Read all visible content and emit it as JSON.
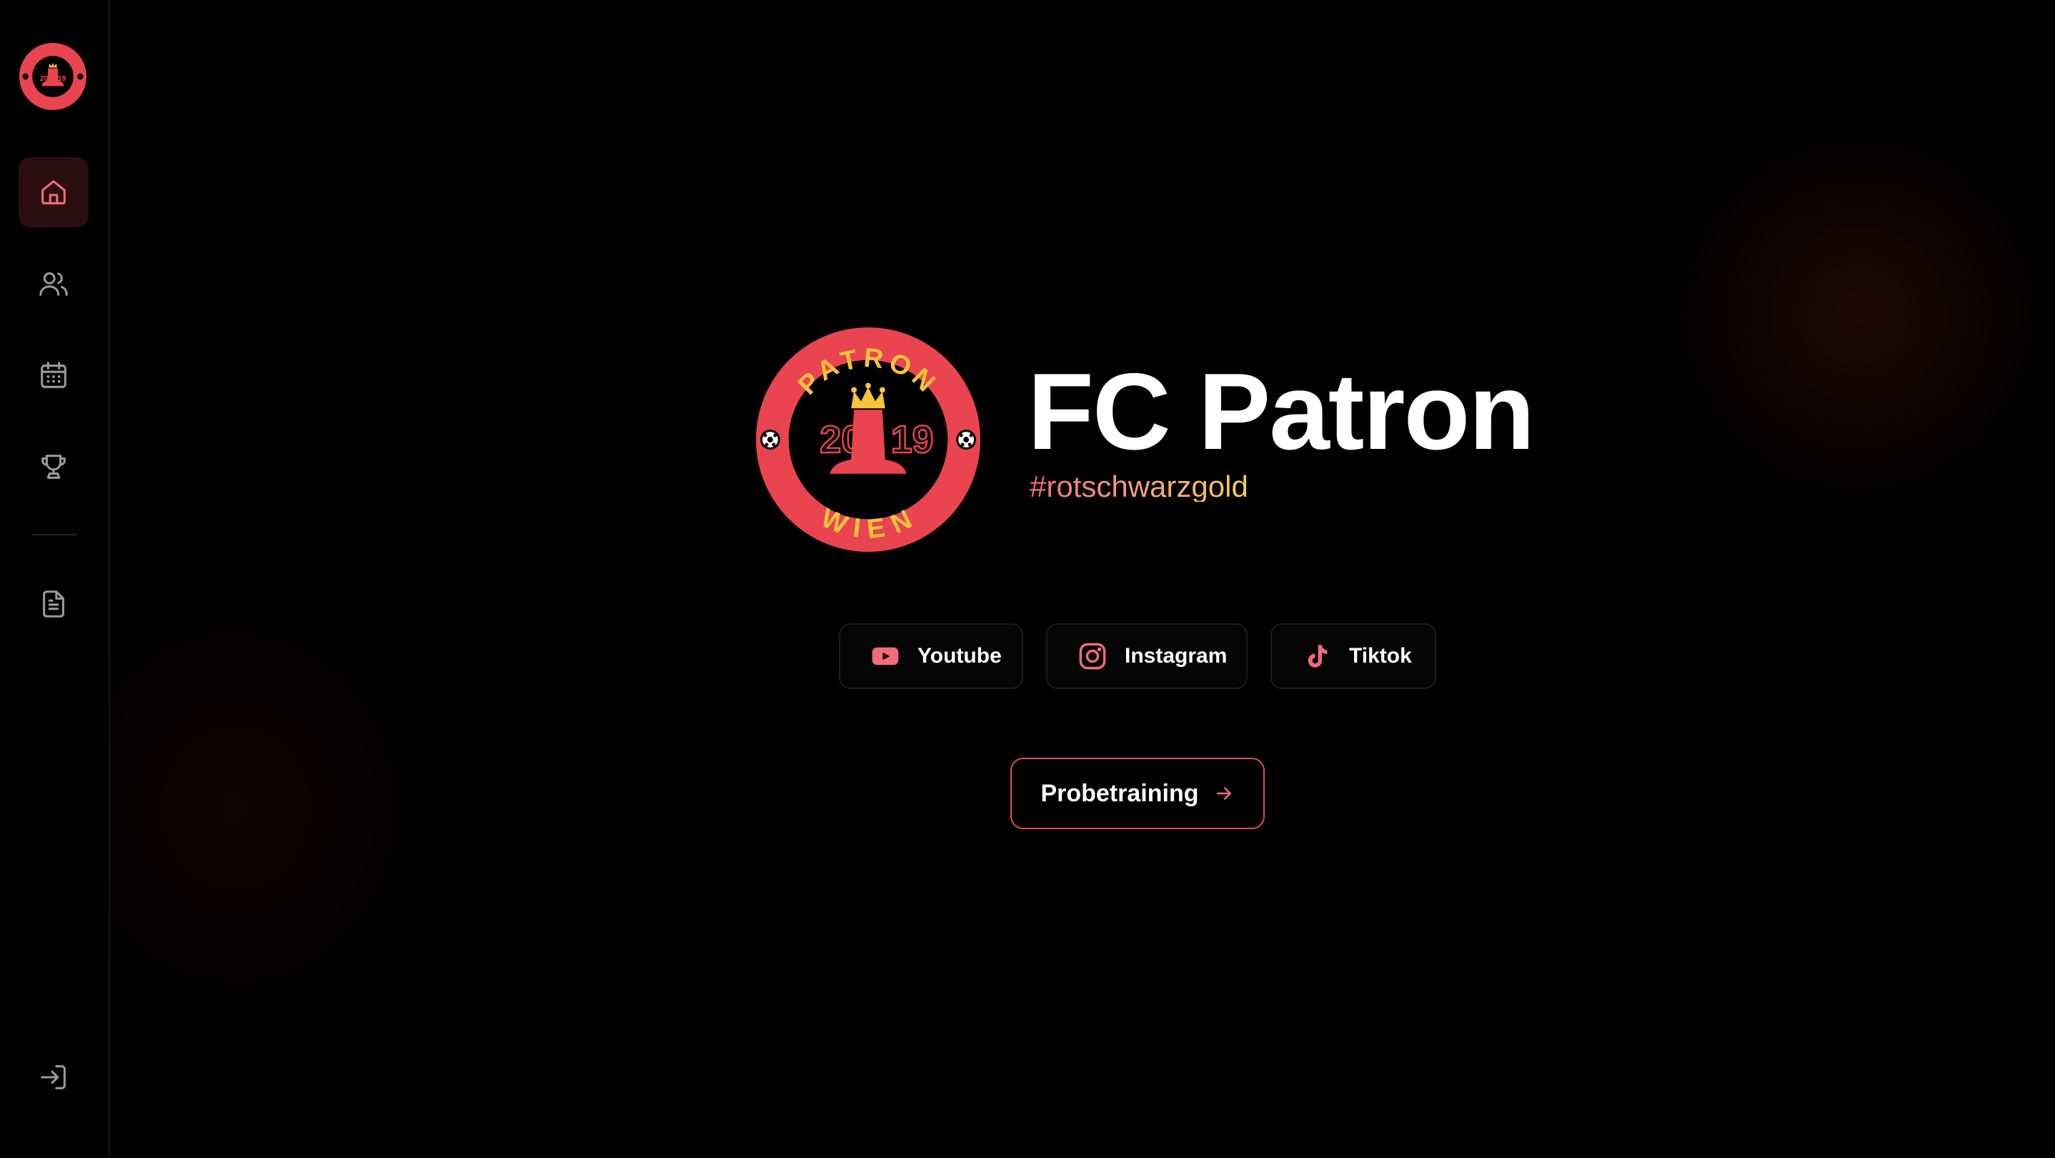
{
  "sidebar": {
    "logo_icon": "club-crest-icon",
    "items": [
      {
        "name": "home",
        "icon": "home-icon",
        "active": true
      },
      {
        "name": "team",
        "icon": "users-icon",
        "active": false
      },
      {
        "name": "calendar",
        "icon": "calendar-icon",
        "active": false
      },
      {
        "name": "trophies",
        "icon": "trophy-icon",
        "active": false
      },
      {
        "name": "documents",
        "icon": "document-icon",
        "active": false
      }
    ],
    "bottom_item": {
      "name": "login",
      "icon": "login-icon"
    }
  },
  "hero": {
    "logo": {
      "top_text": "PATRON",
      "bottom_text": "WIEN",
      "year_left": "20",
      "year_right": "19"
    },
    "title": "FC Patron",
    "tagline": "#rotschwarzgold"
  },
  "socials": [
    {
      "label": "Youtube",
      "icon": "youtube-icon"
    },
    {
      "label": "Instagram",
      "icon": "instagram-icon"
    },
    {
      "label": "Tiktok",
      "icon": "tiktok-icon"
    }
  ],
  "cta": {
    "label": "Probetraining",
    "icon": "arrow-right-icon"
  },
  "colors": {
    "accent": "#e9444f",
    "accent_soft": "#f16b7a",
    "gold": "#f6cf56",
    "background": "#000000",
    "active_nav_bg": "#2a0e10"
  }
}
